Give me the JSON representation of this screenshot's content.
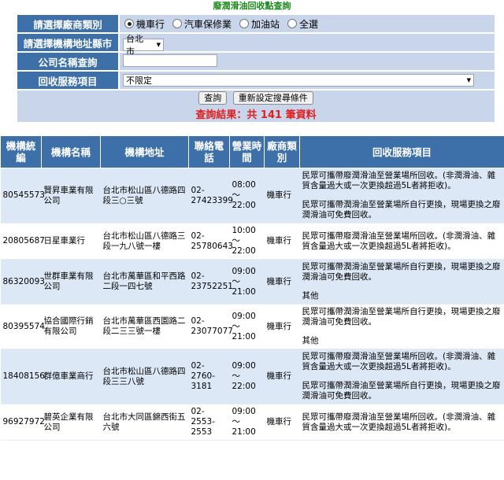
{
  "title": "廢潤滑油回收點查詢",
  "search": {
    "type_label": "請選擇廠商類別",
    "type_options": [
      "機車行",
      "汽車保修業",
      "加油站",
      "全選"
    ],
    "type_selected": 0,
    "county_label": "請選擇機構地址縣市",
    "county_value": "台北市",
    "name_label": "公司名稱查詢",
    "name_value": "",
    "service_label": "回收服務項目",
    "service_value": "不限定",
    "query_button": "查詢",
    "reset_button": "重新設定搜尋條件",
    "result_text": "查詢結果：共 141 筆資料"
  },
  "results": {
    "headers": [
      "機構統編",
      "機構名稱",
      "機構地址",
      "聯絡電話",
      "營業時間",
      "廠商類別",
      "回收服務項目"
    ],
    "rows": [
      {
        "id": "80545573",
        "name": "賢昇車業有限公司",
        "address": "台北市松山區八德路四段三○三號",
        "phone": "02-27423399",
        "hours": "08:00～22:00",
        "type": "機車行",
        "services": [
          "民眾可攜帶廢潤滑油至營業場所回收。(非潤滑油、雜質含量過大或一次更換超過5L者將拒收)。",
          "民眾可攜帶潤滑油至營業場所自行更換，現場更換之廢潤滑油可免費回收。"
        ]
      },
      {
        "id": "20805687",
        "name": "日星車業行",
        "address": "台北市松山區八德路三段一九八號一樓",
        "phone": "02-25780643",
        "hours": "10:00～22:00",
        "type": "機車行",
        "services": [
          "民眾可攜帶廢潤滑油至營業場所回收。(非潤滑油、雜質含量過大或一次更換超過5L者將拒收)。"
        ]
      },
      {
        "id": "86320093",
        "name": "世群車業有限公司",
        "address": "台北市萬華區和平西路二段一四七號",
        "phone": "02-23752251",
        "hours": "09:00～21:00",
        "type": "機車行",
        "services": [
          "民眾可攜帶潤滑油至營業場所自行更換，現場更換之廢潤滑油可免費回收。",
          "其他"
        ]
      },
      {
        "id": "80395574",
        "name": "協合國際行銷有限公司",
        "address": "台北市萬華區西園路二段二三三號一樓",
        "phone": "02-23077077",
        "hours": "09:00～21:00",
        "type": "機車行",
        "services": [
          "民眾可攜帶潤滑油至營業場所自行更換，現場更換之廢潤滑油可免費回收。",
          "其他"
        ]
      },
      {
        "id": "18408156",
        "name": "群億車業商行",
        "address": "台北市松山區八德路四段三三八號",
        "phone": "02-2760-3181",
        "hours": "09:00～22:00",
        "type": "機車行",
        "services": [
          "民眾可攜帶廢潤滑油至營業場所回收。(非潤滑油、雜質含量過大或一次更換超過5L者將拒收)。",
          "民眾可攜帶潤滑油至營業場所自行更換，現場更換之廢潤滑油可免費回收。"
        ]
      },
      {
        "id": "96927972",
        "name": "碧英企業有限公司",
        "address": "台北市大同區錦西街五六號",
        "phone": "02-2553-2553",
        "hours": "09:00～21:00",
        "type": "機車行",
        "services": [
          "民眾可攜帶廢潤滑油至營業場所回收。(非潤滑油、雜質含量過大或一次更換超過5L者將拒收)。"
        ]
      }
    ]
  }
}
